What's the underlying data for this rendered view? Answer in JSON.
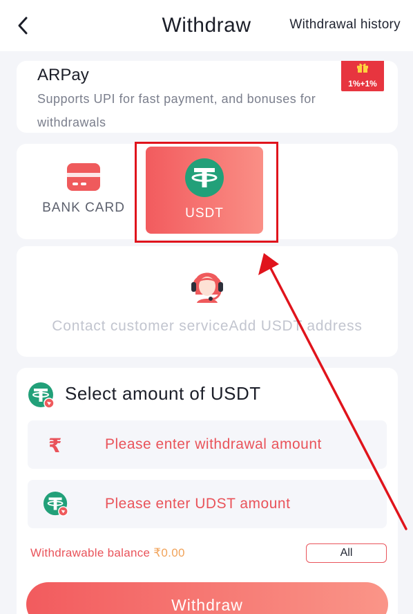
{
  "header": {
    "title": "Withdraw",
    "history_link": "Withdrawal history"
  },
  "arpay": {
    "title": "ARPay",
    "description": "Supports UPI for fast payment, and bonuses for withdrawals",
    "badge": "1%+1%"
  },
  "methods": {
    "bank_label": "BANK CARD",
    "usdt_label": "USDT",
    "selected": "USDT"
  },
  "contact": {
    "text": "Contact customer serviceAdd USDT address"
  },
  "amount": {
    "title": "Select amount of USDT",
    "inr_placeholder": "Please enter withdrawal amount",
    "usdt_placeholder": "Please enter UDST amount",
    "rupee_symbol": "₹",
    "balance_label": "Withdrawable balance ",
    "balance_value": "₹0.00",
    "all_label": "All"
  },
  "withdraw_button": "Withdraw",
  "colors": {
    "accent": "#f25b5e",
    "tether_green": "#22a079",
    "annotation_red": "#e0141c"
  }
}
